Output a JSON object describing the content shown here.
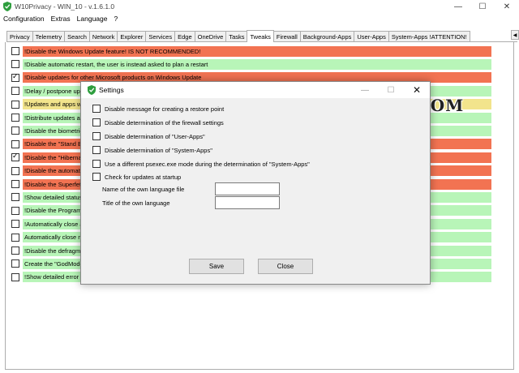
{
  "window": {
    "title": "W10Privacy - WIN_10 - v.1.6.1.0"
  },
  "menu": [
    {
      "label": "Configuration"
    },
    {
      "label": "Extras"
    },
    {
      "label": "Language"
    },
    {
      "label": "?"
    }
  ],
  "tabs": [
    {
      "label": "Privacy"
    },
    {
      "label": "Telemetry"
    },
    {
      "label": "Search"
    },
    {
      "label": "Network"
    },
    {
      "label": "Explorer"
    },
    {
      "label": "Services"
    },
    {
      "label": "Edge"
    },
    {
      "label": "OneDrive"
    },
    {
      "label": "Tasks"
    },
    {
      "label": "Tweaks",
      "active": true
    },
    {
      "label": "Firewall"
    },
    {
      "label": "Background-Apps"
    },
    {
      "label": "User-Apps"
    },
    {
      "label": "System-Apps !ATTENTION!"
    }
  ],
  "rows": [
    {
      "text": "!Disable the Windows Update feature! IS NOT RECOMMENDED!",
      "color": "red",
      "checked": false
    },
    {
      "text": "!Disable automatic restart, the user is instead asked to plan a restart",
      "color": "green",
      "checked": false
    },
    {
      "text": "!Disable updates for other Microsoft products on Windows Update",
      "color": "red",
      "checked": true
    },
    {
      "text": "!Delay / postpone upgr",
      "color": "green",
      "checked": false
    },
    {
      "text": "!Updates and apps will",
      "color": "yellow",
      "checked": false
    },
    {
      "text": "!Distribute updates and",
      "color": "green",
      "checked": false
    },
    {
      "text": "!Disable the biometric lo",
      "color": "green",
      "checked": false
    },
    {
      "text": "!Disable the \"Stand By\"",
      "color": "red",
      "checked": false
    },
    {
      "text": "!Disable the \"Hibernate",
      "color": "red",
      "checked": true
    },
    {
      "text": "!Disable the automatic",
      "color": "red",
      "checked": false
    },
    {
      "text": "!Disable the Superfetch",
      "color": "red",
      "checked": false
    },
    {
      "text": "!Show detailed status m",
      "color": "green",
      "checked": false
    },
    {
      "text": "!Disable the Program Co",
      "color": "green",
      "checked": false
    },
    {
      "text": "!Automatically close app",
      "color": "green",
      "checked": false
    },
    {
      "text": "Automatically close not",
      "color": "green",
      "checked": false
    },
    {
      "text": "!Disable the defragment",
      "color": "green",
      "checked": false
    },
    {
      "text": "Create the \"GodMode\"",
      "color": "green",
      "checked": false
    },
    {
      "text": "!Show detailed error co",
      "color": "green",
      "checked": false
    }
  ],
  "dialog": {
    "title": "Settings",
    "options": [
      {
        "label": "Disable message for creating a restore point",
        "checked": false
      },
      {
        "label": "Disable determination of the firewall settings",
        "checked": false
      },
      {
        "label": "Disable determination of \"User-Apps\"",
        "checked": false
      },
      {
        "label": "Disable determination of \"System-Apps\"",
        "checked": false
      },
      {
        "label": "Use a different psexec.exe mode during the determination of \"System-Apps\"",
        "checked": false
      },
      {
        "label": "Check for updates at startup",
        "checked": false
      }
    ],
    "fields": [
      {
        "label": "Name of the own language file",
        "value": ""
      },
      {
        "label": "Title of the own language",
        "value": ""
      }
    ],
    "save_label": "Save",
    "close_label": "Close"
  },
  "watermark": "MAJORGEEKS.COM",
  "colors": {
    "red": "#f27352",
    "green": "#b8f5b8",
    "yellow": "#f2e48c",
    "app_icon": "#2e9e3e"
  }
}
